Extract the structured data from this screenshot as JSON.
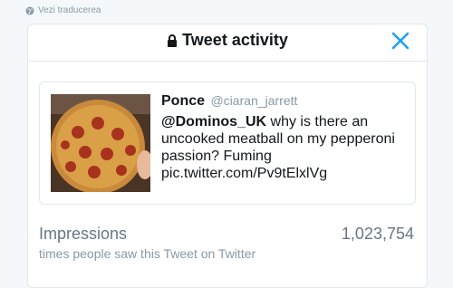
{
  "translate": {
    "label": "Vezi traducerea",
    "icon": "globe-icon"
  },
  "modal": {
    "title": "Tweet activity",
    "lock_icon": "lock-icon",
    "close_icon": "close-icon",
    "accent": "#1da1f2"
  },
  "tweet": {
    "author_name": "Ponce",
    "author_handle": "@ciaran_jarrett",
    "mention": "@Dominos_UK",
    "text_rest": " why is there an uncooked meatball on my pepperoni passion? Fuming",
    "link": "pic.twitter.com/Pv9tElxlVg",
    "image": "pizza-photo"
  },
  "impressions": {
    "label": "Impressions",
    "description": "times people saw this Tweet on Twitter",
    "value": "1,023,754"
  }
}
